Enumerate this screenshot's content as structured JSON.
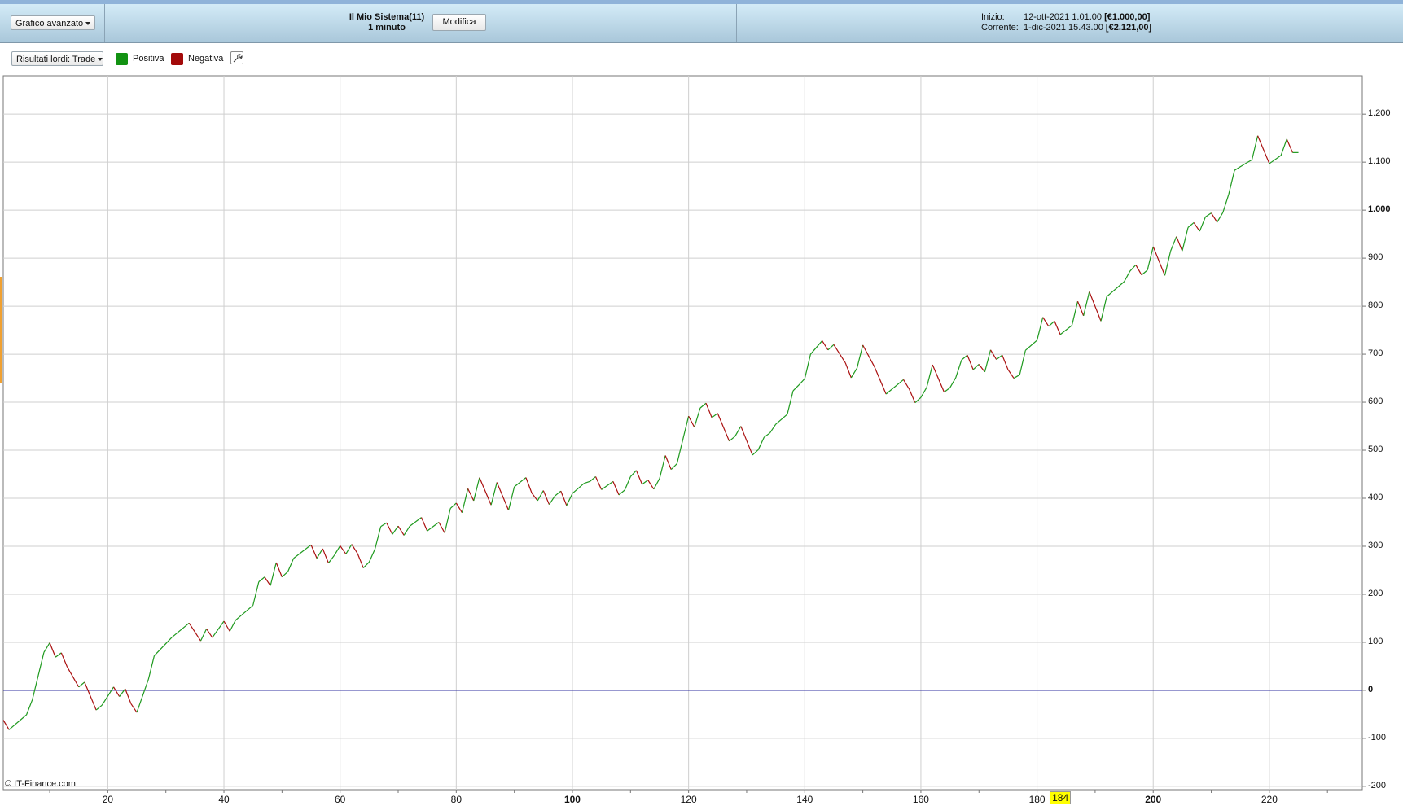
{
  "header": {
    "chart_type_button": "Grafico avanzato",
    "system_name": "Il Mio Sistema(11)",
    "timeframe": "1 minuto",
    "edit_button": "Modifica",
    "start_label": "Inizio:",
    "start_date": "12-ott-2021 1.01.00",
    "start_value": "[€1.000,00]",
    "current_label": "Corrente:",
    "current_date": "1-dic-2021 15.43.00",
    "current_value": "[€2.121,00]"
  },
  "toolbar": {
    "results_dropdown": "Risultati lordi: Trade",
    "legend_positive": "Positiva",
    "legend_negative": "Negativa"
  },
  "colors": {
    "positive": "#1f9a1f",
    "negative": "#aa1010",
    "zero_line": "#3030a0",
    "grid": "#cfcfcf"
  },
  "footer": {
    "copyright": "© IT-Finance.com"
  },
  "chart_data": {
    "type": "line",
    "title": "",
    "xlabel": "Trade",
    "ylabel": "",
    "xlim": [
      2,
      236
    ],
    "ylim": [
      -207,
      1280
    ],
    "x_ticks": [
      "20",
      "40",
      "60",
      "80",
      "100",
      "120",
      "140",
      "160",
      "180",
      "200",
      "220"
    ],
    "x_tick_values": [
      20,
      40,
      60,
      80,
      100,
      120,
      140,
      160,
      180,
      200,
      220
    ],
    "bold_x_ticks": [
      100,
      200
    ],
    "highlighted_x": "184",
    "y_ticks": [
      "1.200",
      "1.100",
      "1.000",
      "900",
      "800",
      "700",
      "600",
      "500",
      "400",
      "300",
      "200",
      "100",
      "0",
      "-100",
      "-200"
    ],
    "y_tick_values": [
      1200,
      1100,
      1000,
      900,
      800,
      700,
      600,
      500,
      400,
      300,
      200,
      100,
      0,
      -100,
      -200
    ],
    "bold_y_ticks": [
      1000,
      0
    ],
    "reference_line": 0,
    "series": [
      {
        "name": "Risultati lordi",
        "x": [
          2,
          3,
          6,
          7,
          9,
          10,
          11,
          12,
          13,
          15,
          16,
          18,
          19,
          21,
          22,
          23,
          24,
          25,
          27,
          28,
          31,
          34,
          36,
          37,
          38,
          40,
          41,
          42,
          45,
          46,
          47,
          48,
          49,
          50,
          51,
          52,
          55,
          56,
          57,
          58,
          59,
          60,
          61,
          62,
          63,
          64,
          65,
          66,
          67,
          68,
          69,
          70,
          71,
          72,
          74,
          75,
          77,
          78,
          79,
          80,
          81,
          82,
          83,
          84,
          86,
          87,
          89,
          90,
          92,
          93,
          94,
          95,
          96,
          97,
          98,
          99,
          100,
          102,
          103,
          104,
          105,
          107,
          108,
          109,
          110,
          111,
          112,
          113,
          114,
          115,
          116,
          117,
          118,
          120,
          121,
          122,
          123,
          124,
          125,
          127,
          128,
          129,
          131,
          132,
          133,
          134,
          135,
          137,
          138,
          139,
          140,
          141,
          143,
          144,
          145,
          147,
          148,
          149,
          150,
          152,
          154,
          157,
          158,
          159,
          160,
          161,
          162,
          164,
          165,
          166,
          167,
          168,
          169,
          170,
          171,
          172,
          173,
          174,
          175,
          176,
          177,
          178,
          180,
          181,
          182,
          183,
          184,
          186,
          187,
          188,
          189,
          191,
          192,
          195,
          196,
          197,
          198,
          199,
          200,
          202,
          203,
          204,
          205,
          206,
          207,
          208,
          209,
          210,
          211,
          212,
          213,
          214,
          216,
          217,
          218,
          220,
          222,
          223,
          224,
          225
        ],
        "y": [
          -62,
          -82,
          -51,
          -20,
          79,
          99,
          69,
          78,
          49,
          7,
          17,
          -41,
          -31,
          7,
          -13,
          3,
          -28,
          -46,
          23,
          72,
          110,
          140,
          103,
          128,
          110,
          144,
          123,
          146,
          177,
          226,
          236,
          218,
          266,
          236,
          247,
          275,
          303,
          275,
          295,
          265,
          281,
          301,
          284,
          304,
          285,
          255,
          267,
          294,
          341,
          349,
          325,
          342,
          323,
          342,
          360,
          332,
          350,
          328,
          379,
          390,
          370,
          420,
          395,
          443,
          386,
          433,
          375,
          424,
          443,
          411,
          395,
          416,
          387,
          405,
          415,
          385,
          410,
          431,
          435,
          445,
          418,
          435,
          407,
          417,
          445,
          458,
          429,
          438,
          419,
          441,
          489,
          460,
          472,
          571,
          548,
          588,
          598,
          568,
          577,
          519,
          529,
          550,
          490,
          501,
          527,
          536,
          554,
          575,
          624,
          636,
          649,
          700,
          728,
          709,
          720,
          682,
          651,
          671,
          719,
          674,
          617,
          647,
          627,
          599,
          610,
          631,
          678,
          621,
          630,
          651,
          688,
          698,
          668,
          679,
          663,
          709,
          689,
          698,
          668,
          650,
          657,
          708,
          729,
          777,
          758,
          769,
          741,
          760,
          810,
          780,
          830,
          769,
          820,
          851,
          873,
          886,
          865,
          875,
          924,
          864,
          915,
          945,
          915,
          964,
          974,
          956,
          986,
          994,
          975,
          995,
          1033,
          1083,
          1098,
          1105,
          1155,
          1097,
          1114,
          1148,
          1120,
          1120
        ]
      }
    ]
  }
}
